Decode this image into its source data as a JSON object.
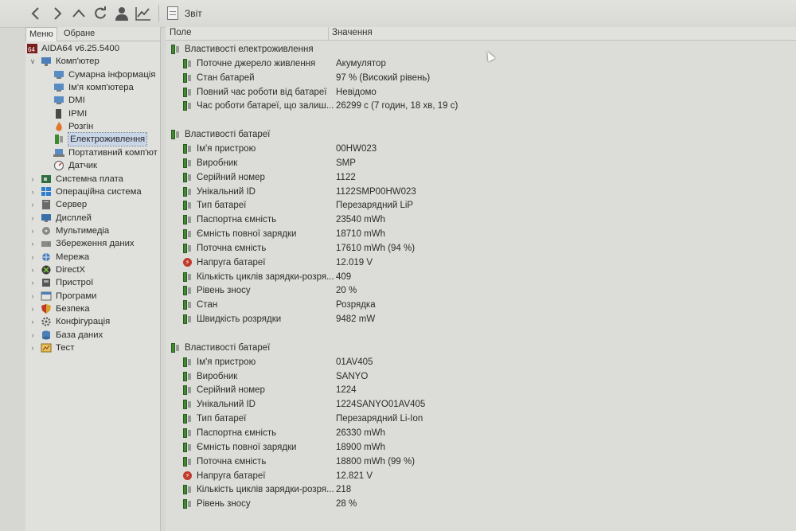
{
  "toolbar": {
    "report_label": "Звіт"
  },
  "left_panel": {
    "tabs": [
      "Меню",
      "Обране"
    ],
    "tree": [
      {
        "label": "AIDA64 v6.25.5400",
        "icon": "aida64-logo-icon",
        "level": 0
      },
      {
        "label": "Комп'ютер",
        "icon": "computer-icon",
        "level": 1,
        "expanded": true
      },
      {
        "label": "Сумарна інформація",
        "icon": "summary-icon",
        "level": 2
      },
      {
        "label": "Ім'я комп'ютера",
        "icon": "computer-name-icon",
        "level": 2
      },
      {
        "label": "DMI",
        "icon": "dmi-icon",
        "level": 2
      },
      {
        "label": "IPMI",
        "icon": "ipmi-icon",
        "level": 2
      },
      {
        "label": "Розгін",
        "icon": "overclock-flame-icon",
        "level": 2
      },
      {
        "label": "Електроживлення",
        "icon": "battery-icon",
        "level": 2,
        "selected": true
      },
      {
        "label": "Портативний комп'ют",
        "icon": "laptop-icon",
        "level": 2
      },
      {
        "label": "Датчик",
        "icon": "sensor-gauge-icon",
        "level": 2
      },
      {
        "label": "Системна плата",
        "icon": "motherboard-icon",
        "level": 1
      },
      {
        "label": "Операційна система",
        "icon": "windows-icon",
        "level": 1
      },
      {
        "label": "Сервер",
        "icon": "server-icon",
        "level": 1
      },
      {
        "label": "Дисплей",
        "icon": "display-icon",
        "level": 1
      },
      {
        "label": "Мультимедіа",
        "icon": "multimedia-icon",
        "level": 1
      },
      {
        "label": "Збереження даних",
        "icon": "storage-icon",
        "level": 1
      },
      {
        "label": "Мережа",
        "icon": "network-icon",
        "level": 1
      },
      {
        "label": "DirectX",
        "icon": "directx-icon",
        "level": 1
      },
      {
        "label": "Пристрої",
        "icon": "devices-icon",
        "level": 1
      },
      {
        "label": "Програми",
        "icon": "programs-icon",
        "level": 1
      },
      {
        "label": "Безпека",
        "icon": "security-shield-icon",
        "level": 1
      },
      {
        "label": "Конфігурація",
        "icon": "configuration-icon",
        "level": 1
      },
      {
        "label": "База даних",
        "icon": "database-icon",
        "level": 1
      },
      {
        "label": "Тест",
        "icon": "benchmark-icon",
        "level": 1
      }
    ]
  },
  "columns": {
    "field": "Поле",
    "value": "Значення"
  },
  "sections": [
    {
      "title": "Властивості електроживлення",
      "rows": [
        {
          "name": "Поточне джерело живлення",
          "value": "Акумулятор",
          "icon": "battery"
        },
        {
          "name": "Стан батарей",
          "value": "97 % (Високий рівень)",
          "icon": "battery"
        },
        {
          "name": "Повний час роботи від батареї",
          "value": "Невідомо",
          "icon": "battery"
        },
        {
          "name": "Час роботи батареї, що залиш...",
          "value": "26299 с (7 годин, 18 хв, 19 с)",
          "icon": "battery"
        }
      ]
    },
    {
      "title": "Властивості батареї",
      "rows": [
        {
          "name": "Ім'я пристрою",
          "value": "00HW023",
          "icon": "battery"
        },
        {
          "name": "Виробник",
          "value": "SMP",
          "icon": "battery"
        },
        {
          "name": "Серійний номер",
          "value": "1122",
          "icon": "battery"
        },
        {
          "name": "Унікальний ID",
          "value": "1122SMP00HW023",
          "icon": "battery"
        },
        {
          "name": "Тип батареї",
          "value": "Перезарядний LiP",
          "icon": "battery"
        },
        {
          "name": "Паспортна ємність",
          "value": "23540 mWh",
          "icon": "battery"
        },
        {
          "name": "Ємність повної зарядки",
          "value": "18710 mWh",
          "icon": "battery"
        },
        {
          "name": "Поточна ємність",
          "value": "17610 mWh  (94 %)",
          "icon": "battery"
        },
        {
          "name": "Напруга батареї",
          "value": "12.019 V",
          "icon": "voltage"
        },
        {
          "name": "Кількість циклів зарядки-розря...",
          "value": "409",
          "icon": "battery"
        },
        {
          "name": "Рівень зносу",
          "value": "20 %",
          "icon": "battery"
        },
        {
          "name": "Стан",
          "value": "Розрядка",
          "icon": "battery"
        },
        {
          "name": "Швидкість розрядки",
          "value": "9482 mW",
          "icon": "battery"
        }
      ]
    },
    {
      "title": "Властивості батареї",
      "rows": [
        {
          "name": "Ім'я пристрою",
          "value": "01AV405",
          "icon": "battery"
        },
        {
          "name": "Виробник",
          "value": "SANYO",
          "icon": "battery"
        },
        {
          "name": "Серійний номер",
          "value": "1224",
          "icon": "battery"
        },
        {
          "name": "Унікальний ID",
          "value": "1224SANYO01AV405",
          "icon": "battery"
        },
        {
          "name": "Тип батареї",
          "value": "Перезарядний Li-Ion",
          "icon": "battery"
        },
        {
          "name": "Паспортна ємність",
          "value": "26330 mWh",
          "icon": "battery"
        },
        {
          "name": "Ємність повної зарядки",
          "value": "18900 mWh",
          "icon": "battery"
        },
        {
          "name": "Поточна ємність",
          "value": "18800 mWh  (99 %)",
          "icon": "battery"
        },
        {
          "name": "Напруга батареї",
          "value": "12.821 V",
          "icon": "voltage"
        },
        {
          "name": "Кількість циклів зарядки-розря...",
          "value": "218",
          "icon": "battery"
        },
        {
          "name": "Рівень зносу",
          "value": "28 %",
          "icon": "battery"
        }
      ]
    }
  ]
}
